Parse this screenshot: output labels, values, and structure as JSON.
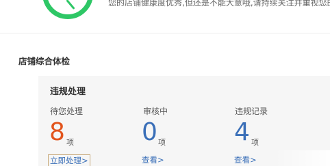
{
  "health": {
    "message": "您的店铺健康度优秀,但还是不能大意哦,请持续关注并重视您的",
    "accent_color": "#2ec766"
  },
  "section": {
    "title": "店铺综合体检"
  },
  "panel": {
    "title": "违规处理",
    "stats": [
      {
        "label": "待您处理",
        "value": "8",
        "unit": "项",
        "link": "立即处理>",
        "color": "#e2541c"
      },
      {
        "label": "审核中",
        "value": "0",
        "unit": "项",
        "link": "查看>",
        "color": "#3a6fb8"
      },
      {
        "label": "违规记录",
        "value": "4",
        "unit": "项",
        "link": "查看>",
        "color": "#3a6fb8"
      }
    ]
  }
}
